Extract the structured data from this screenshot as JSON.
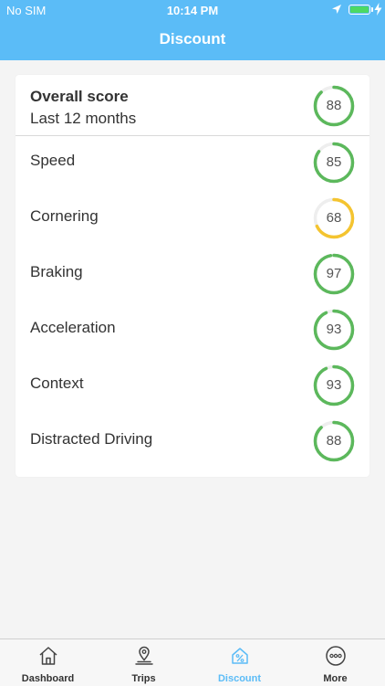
{
  "status_bar": {
    "carrier": "No SIM",
    "time": "10:14 PM",
    "battery_color": "#4cd964"
  },
  "header": {
    "title": "Discount",
    "color": "#5bbcf7"
  },
  "overall": {
    "title": "Overall score",
    "subtitle": "Last 12 months",
    "score": "88",
    "fraction": 0.88,
    "color": "#5cb85c"
  },
  "scores": [
    {
      "label": "Speed",
      "score": "85",
      "fraction": 0.85,
      "color": "#5cb85c"
    },
    {
      "label": "Cornering",
      "score": "68",
      "fraction": 0.68,
      "color": "#f4c430"
    },
    {
      "label": "Braking",
      "score": "97",
      "fraction": 0.97,
      "color": "#5cb85c"
    },
    {
      "label": "Acceleration",
      "score": "93",
      "fraction": 0.93,
      "color": "#5cb85c"
    },
    {
      "label": "Context",
      "score": "93",
      "fraction": 0.93,
      "color": "#5cb85c"
    },
    {
      "label": "Distracted Driving",
      "score": "88",
      "fraction": 0.88,
      "color": "#5cb85c"
    }
  ],
  "tabs": [
    {
      "label": "Dashboard",
      "icon": "home-icon",
      "active": false
    },
    {
      "label": "Trips",
      "icon": "location-pin-icon",
      "active": false
    },
    {
      "label": "Discount",
      "icon": "discount-tag-icon",
      "active": true
    },
    {
      "label": "More",
      "icon": "more-dots-icon",
      "active": false
    }
  ]
}
